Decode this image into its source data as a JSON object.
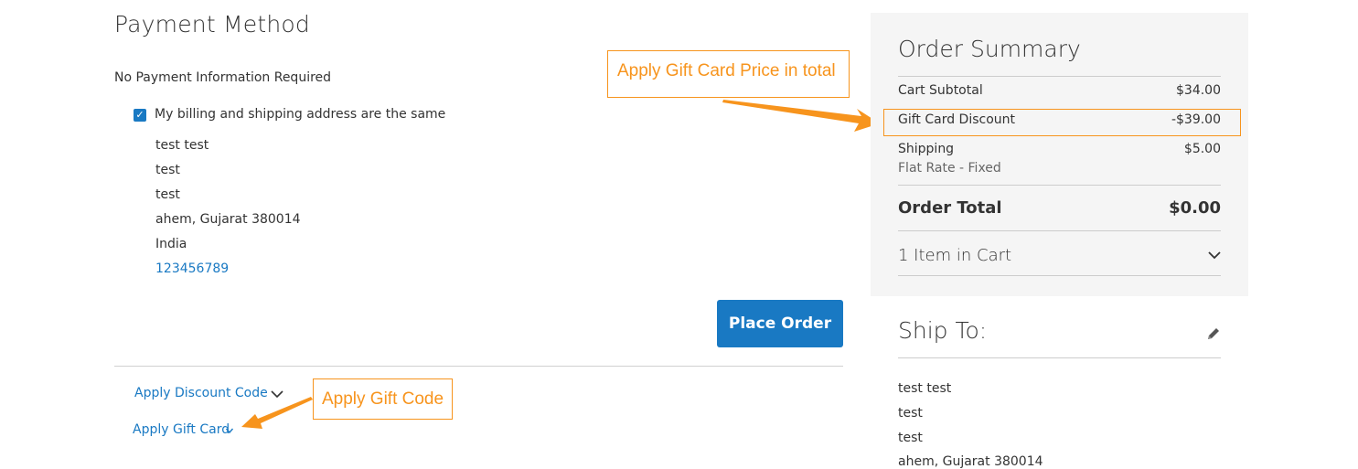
{
  "payment": {
    "title": "Payment Method",
    "no_payment_info": "No Payment Information Required",
    "same_address_label": "My billing and shipping address are the same",
    "same_address_checked": true,
    "address_lines": [
      "test test",
      "test",
      "test",
      "ahem, Gujarat 380014",
      "India"
    ],
    "phone": "123456789",
    "place_order_label": "Place Order",
    "apply_discount_label": "Apply Discount Code",
    "apply_gift_card_label": "Apply Gift Card"
  },
  "annotations": {
    "gift_card_total": "Apply Gift Card Price in total",
    "gift_code": "Apply Gift Code",
    "color": "#f7941d"
  },
  "order_summary": {
    "title": "Order Summary",
    "rows": [
      {
        "label": "Cart Subtotal",
        "value": "$34.00"
      },
      {
        "label": "Gift Card Discount",
        "value": "-$39.00"
      },
      {
        "label": "Shipping",
        "value": "$5.00"
      }
    ],
    "shipping_method": "Flat Rate - Fixed",
    "total_label": "Order Total",
    "total_value": "$0.00",
    "items_in_cart": "1 Item in Cart"
  },
  "ship_to": {
    "title": "Ship To:",
    "address_lines": [
      "test test",
      "test",
      "test",
      "ahem, Gujarat 380014"
    ]
  },
  "colors": {
    "primary": "#1979c3",
    "accent": "#f7941d",
    "summary_bg": "#f5f5f5"
  },
  "icons": {
    "checkbox": "checkmark-icon",
    "discount_toggle": "chevron-down-icon",
    "gift_toggle": "chevron-down-icon",
    "items_toggle": "chevron-down-icon",
    "edit_ship_to": "pencil-icon"
  }
}
